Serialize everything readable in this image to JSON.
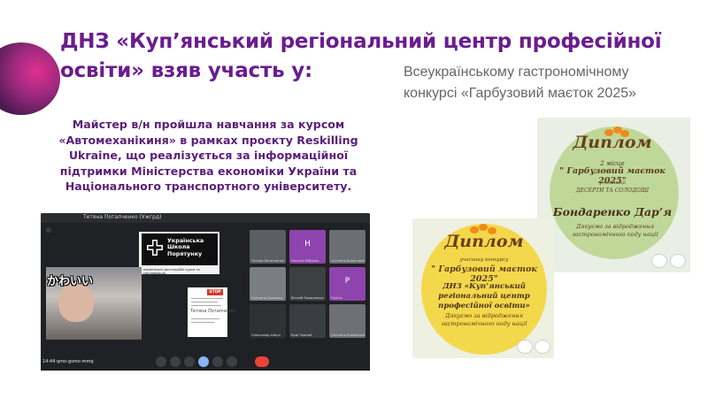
{
  "slide": {
    "title": "ДНЗ «Куп’янський регіональний центр професійної освіти» взяв участь у:",
    "contest_line1": "Всеукраїнському гастрономічному",
    "contest_line2": "конкурсі «Гарбузовий маєток 2025»",
    "paragraph": "Майстер в/н пройшла навчання за курсом «Автомеханікиня» в рамках проєкту Reskilling Ukraine, що реалізується за інформаційної підтримки Міністерства економіки України та Національного транспортного університету."
  },
  "meeting": {
    "window_title": "Тетяна Потапченко (Ужгрд)",
    "time": "14:44",
    "meeting_code": "qmo-gsmo-mmq",
    "logo_text": "Українська Школа Порятунку",
    "logo_subtitle": "національні дистанційні курси та сертифікація",
    "sticker_text": "かわいい",
    "cert_logo": "STOP",
    "cert_signature": "Тетяна Потапченко",
    "participants": [
      {
        "name": "Тетяна Потапченко",
        "letter": "",
        "color": "#5b5f64"
      },
      {
        "name": "Наталія Рибалка",
        "letter": "Н",
        "color": "#8e44ad"
      },
      {
        "name": "Світлана Берестова",
        "letter": "",
        "color": "#6b6e73"
      },
      {
        "name": "Світлана Ляшенко",
        "letter": "",
        "color": "#7a7d82"
      },
      {
        "name": "Віталій Захарченко",
        "letter": "",
        "color": "#3d4043"
      },
      {
        "name": "Поліна",
        "letter": "P",
        "color": "#8e44ad"
      },
      {
        "name": "Олександр Шмул",
        "letter": "",
        "color": "#2f3134"
      },
      {
        "name": "Ерді Чорний",
        "letter": "",
        "color": "#3a3d41"
      },
      {
        "name": "Світлана Коваленко",
        "letter": "",
        "color": "#6e7075"
      }
    ]
  },
  "diploma_back": {
    "title": "Диплом",
    "place": "2 місце",
    "contest": "\" Гарбузовий маєток 2025\"",
    "nomination_label": "у номінації",
    "nomination": "ДЕСЕРТИ ТА СОЛОДОЩІ",
    "recipient": "Бондаренко Дар’я",
    "thanks": "Дякуємо за відродження гастрономічного коду нації"
  },
  "diploma_front": {
    "title": "Диплом",
    "subtitle": "учаснику конкурсу",
    "contest": "\" Гарбузовий маєток 2025\"",
    "recipient": "ДНЗ «Куп’янський регіональний центр професійної освіти»",
    "thanks": "Дякуємо за відродження гастрономічного коду нації"
  },
  "colors": {
    "title": "#6a1d8e",
    "paragraph": "#5a1f7a",
    "contest": "#666666",
    "diploma_green": "#bfd89a",
    "diploma_orange": "#f4d84b"
  }
}
